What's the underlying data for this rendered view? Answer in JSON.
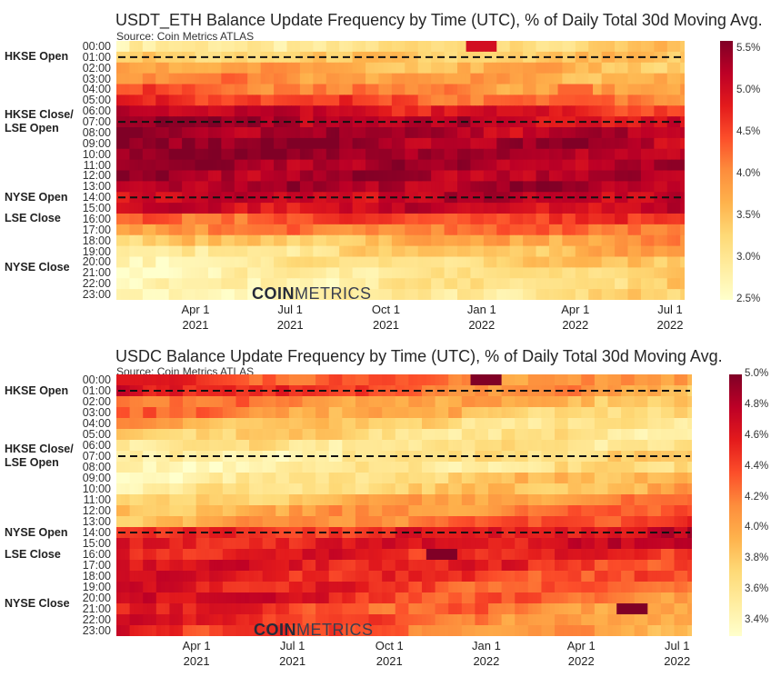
{
  "chart_data": [
    {
      "type": "heatmap",
      "title": "USDT_ETH Balance Update Frequency by Time (UTC), % of Daily Total 30d Moving Avg.",
      "subtitle": "Source: Coin Metrics ATLAS",
      "xlabel": "",
      "ylabel": "",
      "y_categories": [
        "00:00",
        "01:00",
        "02:00",
        "03:00",
        "04:00",
        "05:00",
        "06:00",
        "07:00",
        "08:00",
        "09:00",
        "10:00",
        "11:00",
        "12:00",
        "13:00",
        "14:00",
        "15:00",
        "16:00",
        "17:00",
        "18:00",
        "19:00",
        "20:00",
        "21:00",
        "22:00",
        "23:00"
      ],
      "x_range": [
        "2021-01-15",
        "2022-07-15"
      ],
      "x_ticks": [
        {
          "label": "Apr 1",
          "year": "2021",
          "date": "2021-04-01"
        },
        {
          "label": "Jul 1",
          "year": "2021",
          "date": "2021-07-01"
        },
        {
          "label": "Oct 1",
          "year": "2021",
          "date": "2021-10-01"
        },
        {
          "label": "Jan 1",
          "year": "2022",
          "date": "2022-01-01"
        },
        {
          "label": "Apr 1",
          "year": "2022",
          "date": "2022-04-01"
        },
        {
          "label": "Jul 1",
          "year": "2022",
          "date": "2022-07-01"
        }
      ],
      "colorbar": {
        "min": 2.5,
        "max": 5.6,
        "ticks": [
          "2.5%",
          "3.0%",
          "3.5%",
          "4.0%",
          "4.5%",
          "5.0%",
          "5.5%"
        ],
        "colormap": "YlOrRd"
      },
      "hour_profile_start": [
        2.8,
        3.3,
        3.9,
        4.1,
        4.4,
        4.8,
        5.3,
        5.5,
        5.5,
        5.6,
        5.6,
        5.5,
        5.4,
        5.4,
        5.1,
        5.0,
        4.3,
        4.0,
        3.3,
        2.8,
        2.7,
        2.6,
        2.6,
        2.6
      ],
      "hour_profile_end": [
        3.4,
        3.4,
        3.5,
        3.6,
        3.7,
        4.1,
        4.6,
        4.9,
        5.1,
        5.2,
        5.2,
        5.2,
        5.2,
        5.3,
        5.2,
        5.0,
        4.6,
        4.3,
        4.0,
        3.8,
        3.6,
        3.4,
        3.3,
        3.3
      ],
      "hotspots": [
        {
          "hour": "00:00",
          "date": "2022-01-01",
          "value": 5.0
        },
        {
          "hour": "04:00",
          "date": "2022-04-01",
          "value": 4.3
        }
      ],
      "annotations": [
        {
          "label": "HKSE Open",
          "hour": "01:30",
          "line": true
        },
        {
          "label": "HKSE Close/\nLSE Open",
          "hour": "07:30",
          "line": true
        },
        {
          "label": "NYSE Open",
          "hour": "14:30",
          "line": true
        },
        {
          "label": "LSE Close",
          "hour": "16:30",
          "line": false
        },
        {
          "label": "NYSE Close",
          "hour": "21:00",
          "line": false
        }
      ]
    },
    {
      "type": "heatmap",
      "title": "USDC Balance Update Frequency by Time (UTC), % of Daily Total 30d Moving Avg.",
      "subtitle": "Source: Coin Metrics ATLAS",
      "xlabel": "",
      "ylabel": "",
      "y_categories": [
        "00:00",
        "01:00",
        "02:00",
        "03:00",
        "04:00",
        "05:00",
        "06:00",
        "07:00",
        "08:00",
        "09:00",
        "10:00",
        "11:00",
        "12:00",
        "13:00",
        "14:00",
        "15:00",
        "16:00",
        "17:00",
        "18:00",
        "19:00",
        "20:00",
        "21:00",
        "22:00",
        "23:00"
      ],
      "x_range": [
        "2021-01-15",
        "2022-07-15"
      ],
      "x_ticks": [
        {
          "label": "Apr 1",
          "year": "2021",
          "date": "2021-04-01"
        },
        {
          "label": "Jul 1",
          "year": "2021",
          "date": "2021-07-01"
        },
        {
          "label": "Oct 1",
          "year": "2021",
          "date": "2021-10-01"
        },
        {
          "label": "Jan 1",
          "year": "2022",
          "date": "2022-01-01"
        },
        {
          "label": "Apr 1",
          "year": "2022",
          "date": "2022-04-01"
        },
        {
          "label": "Jul 1",
          "year": "2022",
          "date": "2022-07-01"
        }
      ],
      "colorbar": {
        "min": 3.3,
        "max": 5.0,
        "ticks": [
          "3.4%",
          "3.6%",
          "3.8%",
          "4.0%",
          "4.2%",
          "4.4%",
          "4.6%",
          "4.8%",
          "5.0%"
        ],
        "colormap": "YlOrRd"
      },
      "hour_profile_start": [
        4.5,
        4.7,
        4.3,
        4.3,
        4.0,
        3.8,
        3.6,
        3.4,
        3.4,
        3.4,
        3.5,
        3.6,
        3.8,
        3.9,
        4.4,
        4.5,
        4.6,
        4.7,
        4.7,
        4.7,
        4.8,
        4.6,
        4.7,
        4.6
      ],
      "hour_profile_end": [
        4.0,
        3.9,
        3.8,
        3.6,
        3.5,
        3.5,
        3.6,
        3.8,
        3.7,
        4.0,
        4.0,
        4.3,
        4.4,
        4.5,
        4.7,
        4.7,
        4.5,
        4.4,
        4.3,
        4.2,
        4.1,
        4.0,
        3.9,
        3.9
      ],
      "hotspots": [
        {
          "hour": "00:00",
          "date": "2022-01-01",
          "value": 5.0
        },
        {
          "hour": "21:00",
          "date": "2022-05-20",
          "value": 5.0
        },
        {
          "hour": "16:00",
          "date": "2021-11-20",
          "value": 5.0
        }
      ],
      "annotations": [
        {
          "label": "HKSE Open",
          "hour": "01:30",
          "line": true
        },
        {
          "label": "HKSE Close/\nLSE Open",
          "hour": "07:30",
          "line": true
        },
        {
          "label": "NYSE Open",
          "hour": "14:30",
          "line": true
        },
        {
          "label": "LSE Close",
          "hour": "16:30",
          "line": false
        },
        {
          "label": "NYSE Close",
          "hour": "21:00",
          "line": false
        }
      ]
    }
  ],
  "watermark": {
    "bold": "COIN",
    "light": "METRICS"
  }
}
